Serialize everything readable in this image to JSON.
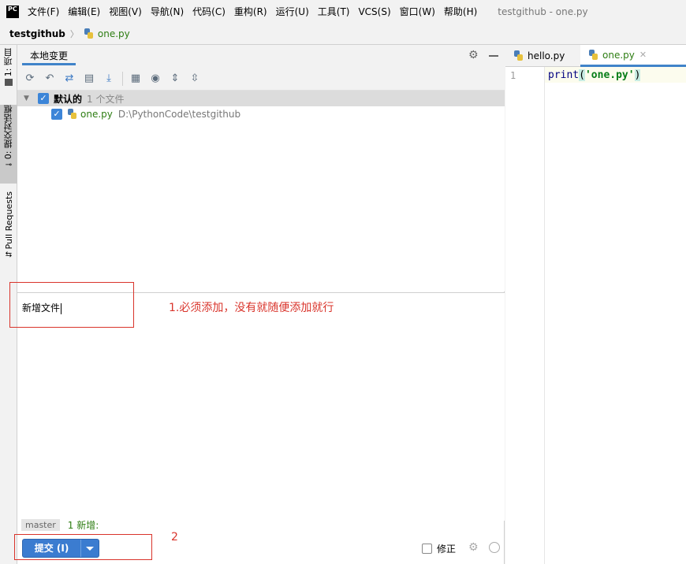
{
  "menubar": {
    "logo": "PC",
    "items": [
      "文件(F)",
      "编辑(E)",
      "视图(V)",
      "导航(N)",
      "代码(C)",
      "重构(R)",
      "运行(U)",
      "工具(T)",
      "VCS(S)",
      "窗口(W)",
      "帮助(H)"
    ],
    "window_title": "testgithub - one.py"
  },
  "breadcrumb": {
    "project": "testgithub",
    "file": "one.py"
  },
  "left_strip": {
    "project": "1: 项目",
    "commit": "0: 提交对话框",
    "pull_requests": "Pull Requests"
  },
  "commit_panel": {
    "tab": "本地变更",
    "changelist": {
      "name": "默认的",
      "count": "1 个文件"
    },
    "file": {
      "name": "one.py",
      "path": "D:\\PythonCode\\testgithub"
    },
    "message": "新增文件",
    "branch": "master",
    "status": "1 新增:",
    "commit_button": "提交 (I)",
    "amend_label": "修正"
  },
  "annotations": {
    "note1": "1.必须添加，没有就随便添加就行",
    "note2": "2"
  },
  "editor": {
    "tabs": [
      "hello.py",
      "one.py"
    ],
    "line_number": "1",
    "code": {
      "func": "print",
      "open": "(",
      "string": "'one.py'",
      "close": ")"
    }
  },
  "colors": {
    "accent": "#3b7cd0",
    "annotation": "#d9342b",
    "file_green": "#2d7d12"
  }
}
